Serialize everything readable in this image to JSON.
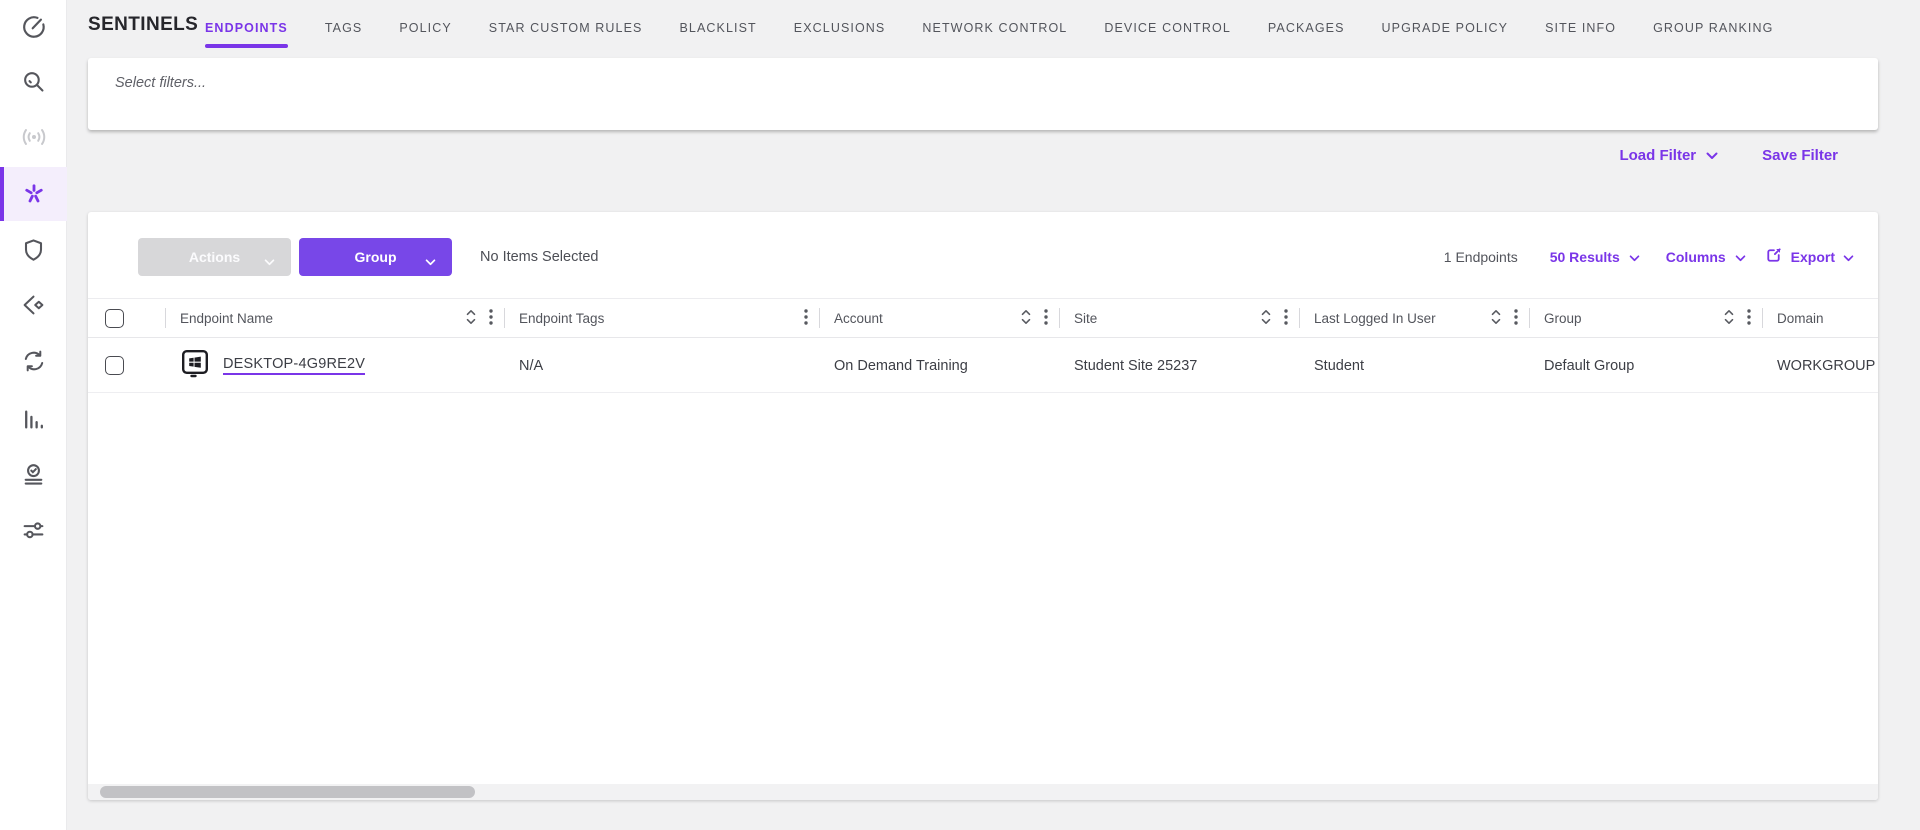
{
  "app": {
    "title": "SENTINELS"
  },
  "nav": {
    "tabs": [
      {
        "label": "ENDPOINTS",
        "active": true
      },
      {
        "label": "TAGS"
      },
      {
        "label": "POLICY"
      },
      {
        "label": "STAR CUSTOM RULES"
      },
      {
        "label": "BLACKLIST"
      },
      {
        "label": "EXCLUSIONS"
      },
      {
        "label": "NETWORK CONTROL"
      },
      {
        "label": "DEVICE CONTROL"
      },
      {
        "label": "PACKAGES"
      },
      {
        "label": "UPGRADE POLICY"
      },
      {
        "label": "SITE INFO"
      },
      {
        "label": "GROUP RANKING"
      }
    ]
  },
  "filters": {
    "placeholder": "Select filters...",
    "load_label": "Load Filter",
    "save_label": "Save Filter"
  },
  "toolbar": {
    "actions_label": "Actions",
    "group_label": "Group",
    "selection_status": "No Items Selected",
    "endpoint_count": "1 Endpoints",
    "results_label": "50 Results",
    "columns_label": "Columns",
    "export_label": "Export"
  },
  "table": {
    "columns": [
      {
        "label": "Endpoint Name",
        "sortable": true
      },
      {
        "label": "Endpoint Tags",
        "sortable": false
      },
      {
        "label": "Account",
        "sortable": true
      },
      {
        "label": "Site",
        "sortable": true
      },
      {
        "label": "Last Logged In User",
        "sortable": true
      },
      {
        "label": "Group",
        "sortable": true
      },
      {
        "label": "Domain",
        "sortable": false
      }
    ],
    "rows": [
      {
        "os_icon": "windows-icon",
        "endpoint_name": "DESKTOP-4G9RE2V",
        "endpoint_tags": "N/A",
        "account": "On Demand Training",
        "site": "Student Site 25237",
        "last_logged_in_user": "Student",
        "group": "Default Group",
        "domain": "WORKGROUP"
      }
    ]
  },
  "sidebar": {
    "icons": [
      "dashboard-icon",
      "search-icon",
      "network-activity-icon",
      "sentinels-icon",
      "threats-shield-icon",
      "visibility-icon",
      "activity-sync-icon",
      "reports-icon",
      "tasks-icon",
      "settings-sliders-icon"
    ],
    "active_icon": "sentinels-icon"
  },
  "colors": {
    "accent_purple": "#7a35e8",
    "button_purple": "#7847e8",
    "disabled_gray": "#d7d7d9",
    "page_bg": "#f1f1f2",
    "scroll_thumb": "#c2c2c5"
  }
}
